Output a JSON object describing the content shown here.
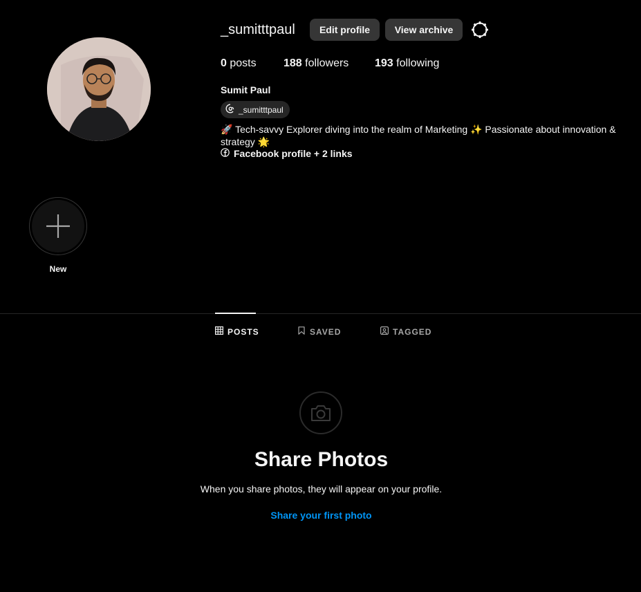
{
  "profile": {
    "username": "_sumitttpaul",
    "full_name": "Sumit Paul",
    "threads_handle": "_sumitttpaul",
    "bio": "🚀 Tech-savvy Explorer diving into the realm of Marketing ✨ Passionate about innovation & strategy 🌟",
    "links_text": "Facebook profile + 2 links"
  },
  "actions": {
    "edit_profile": "Edit profile",
    "view_archive": "View archive",
    "settings_icon": "gear-icon"
  },
  "stats": {
    "posts_count": "0",
    "posts_label": "posts",
    "followers_count": "188",
    "followers_label": "followers",
    "following_count": "193",
    "following_label": "following"
  },
  "highlights": {
    "new_label": "New"
  },
  "tabs": [
    {
      "label": "POSTS",
      "icon": "grid-icon",
      "active": true
    },
    {
      "label": "SAVED",
      "icon": "bookmark-icon",
      "active": false
    },
    {
      "label": "TAGGED",
      "icon": "tagged-icon",
      "active": false
    }
  ],
  "empty_state": {
    "icon": "camera-icon",
    "title": "Share Photos",
    "subtitle": "When you share photos, they will appear on your profile.",
    "link": "Share your first photo"
  },
  "colors": {
    "background": "#000000",
    "button_bg": "#363636",
    "link_blue": "#0095f6",
    "muted_text": "#a8a8a8"
  }
}
